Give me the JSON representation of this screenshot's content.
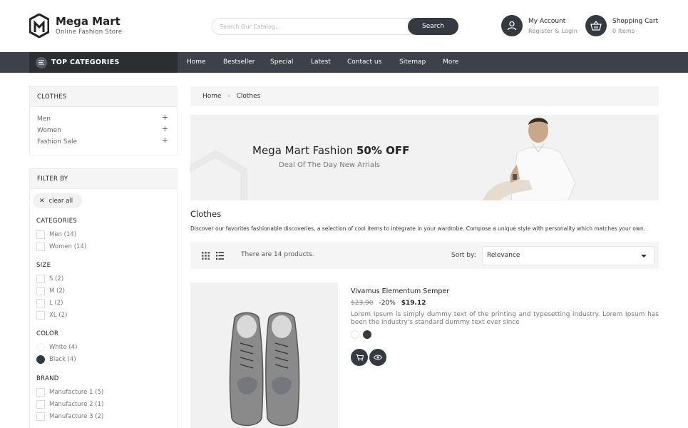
{
  "brand": {
    "title": "Mega Mart",
    "subtitle": "Online Fashion Store"
  },
  "search": {
    "placeholder": "Search Our Catalog...",
    "button": "Search"
  },
  "account": {
    "title": "My Account",
    "sub": "Register & Login"
  },
  "cart": {
    "title": "Shopping Cart",
    "sub": "0 Items"
  },
  "nav": {
    "top_categories": "TOP CATEGORIES",
    "links": [
      "Home",
      "Bestseller",
      "Special",
      "Latest",
      "Contact us",
      "Sitemap",
      "More"
    ]
  },
  "sidebar": {
    "categories_title": "CLOTHES",
    "categories": [
      "Men",
      "Women",
      "Fashion Sale"
    ],
    "filter_title": "FILTER BY",
    "clear_all": "clear all",
    "categories_facet": {
      "title": "CATEGORIES",
      "options": [
        "Men (14)",
        "Women (14)"
      ]
    },
    "size_facet": {
      "title": "SIZE",
      "options": [
        "S (2)",
        "M (2)",
        "L (2)",
        "XL (2)"
      ]
    },
    "color_facet": {
      "title": "COLOR",
      "options": [
        "White (4)",
        "Black (4)"
      ]
    },
    "brand_facet": {
      "title": "BRAND",
      "options": [
        "Manufacture 1 (5)",
        "Manufacture 2 (1)",
        "Manufacture 3 (2)"
      ]
    }
  },
  "breadcrumb": {
    "home": "Home",
    "sep": "-",
    "current": "Clothes"
  },
  "banner": {
    "title_plain": "Mega Mart Fashion",
    "title_bold": "50% OFF",
    "subtitle": "Deal Of The Day New Arrials"
  },
  "category": {
    "title": "Clothes",
    "description": "Discover our favorites fashionable discoveries, a selection of cool items to integrate in your wardrobe. Compose a unique style with personality which matches your own."
  },
  "toolbar": {
    "count": "There are 14 products.",
    "sort_label": "Sort by:",
    "sort_value": "Relevance"
  },
  "product": {
    "name": "Vivamus Elementum Semper",
    "price_old": "$23.90",
    "discount": "-20%",
    "price_new": "$19.12",
    "description": "Lorem Ipsum is simply dummy text of the printing and typesetting industry. Lorem Ipsum has been the industry's standard dummy text ever since"
  },
  "colors": {
    "dark": "#343a40",
    "nav": "#3d4249",
    "white_swatch": "#ffffff",
    "black_swatch": "#343a40"
  }
}
